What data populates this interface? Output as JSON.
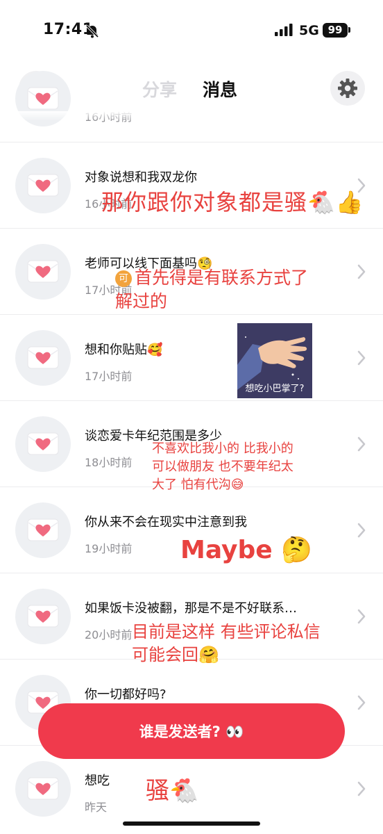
{
  "status": {
    "time": "17:41",
    "network": "5G",
    "battery": "99"
  },
  "header": {
    "tab_share": "分享",
    "tab_messages": "消息"
  },
  "messages": [
    {
      "text": "",
      "time": "16小时前"
    },
    {
      "text": "对象说想和我双龙你",
      "time": "16小时前"
    },
    {
      "text": "老师可以线下面基吗🧐",
      "time": "17小时前"
    },
    {
      "text": "想和你贴贴🥰",
      "time": "17小时前"
    },
    {
      "text": "谈恋爱卡年纪范围是多少",
      "time": "18小时前"
    },
    {
      "text": "你从来不会在现实中注意到我",
      "time": "19小时前"
    },
    {
      "text": "如果饭卡没被翻，那是不是不好联系…",
      "time": "20小时前"
    },
    {
      "text": "你一切都好吗?",
      "time": ""
    },
    {
      "text": "想吃",
      "time": "昨天"
    }
  ],
  "sticker": {
    "caption": "想吃小巴掌了?"
  },
  "annotations": {
    "a1": "那你跟你对象都是骚🐔👍",
    "a2_badge": "可",
    "a2_line1": "首先得是有联系方式了",
    "a2_line2": "解过的",
    "a3_line1": "不喜欢比我小的 比我小的",
    "a3_line2": "可以做朋友 也不要年纪太",
    "a3_line3": "大了 怕有代沟😅",
    "a4": "Maybe 🤔",
    "a5_line1": "目前是这样 有些评论私信",
    "a5_line2": "可能会回🤗",
    "a6": "骚🐔"
  },
  "cta": {
    "label": "谁是发送者? 👀"
  },
  "icons": {
    "eye": "eye-icon",
    "gear": "gear-icon",
    "envelope": "envelope-heart-icon",
    "chevron": "chevron-right-icon"
  }
}
